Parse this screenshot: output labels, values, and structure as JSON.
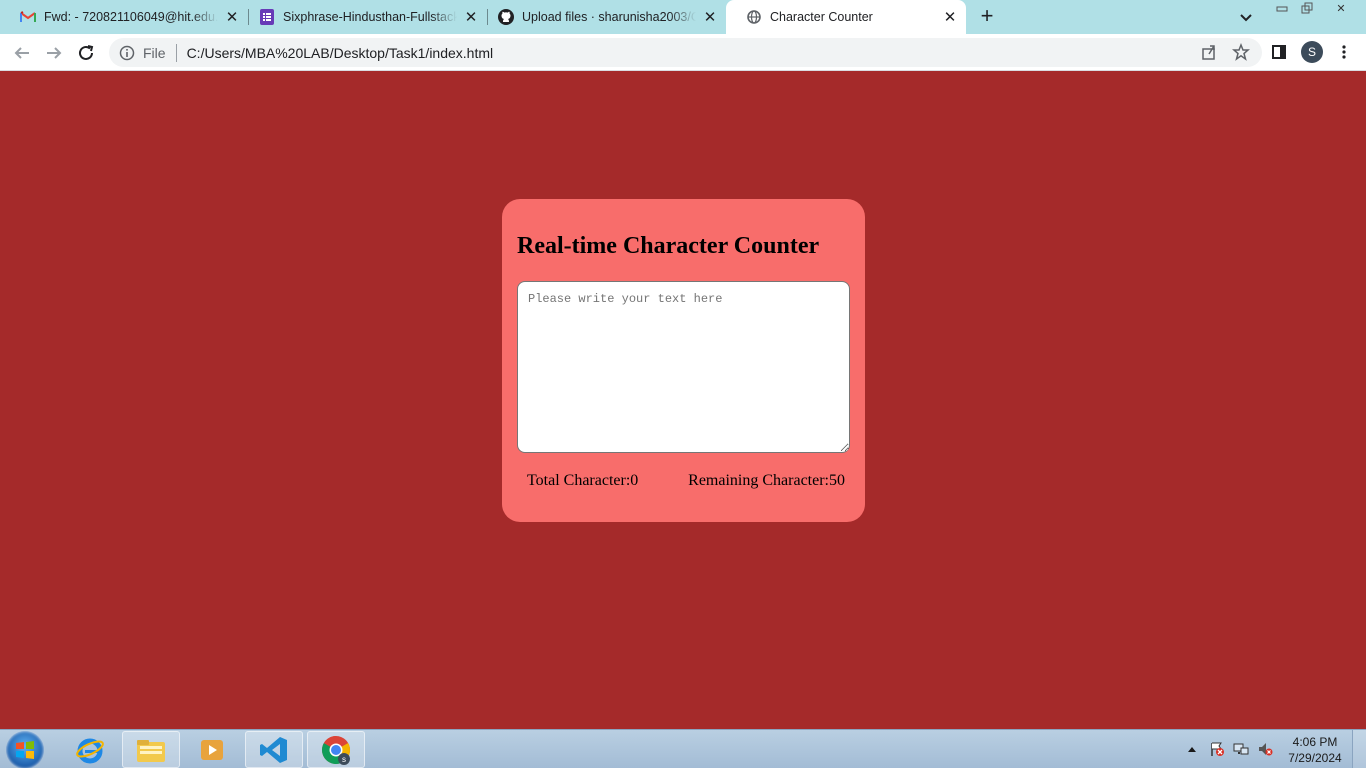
{
  "browser": {
    "tabs": [
      {
        "title": "Fwd: - 720821106049@hit.edu.in",
        "icon": "gmail-icon",
        "active": false
      },
      {
        "title": "Sixphrase-Hindusthan-Fullstack r",
        "icon": "forms-icon",
        "active": false
      },
      {
        "title": "Upload files · sharunisha2003/Ch",
        "icon": "github-icon",
        "active": false
      },
      {
        "title": "Character Counter",
        "icon": "globe-icon",
        "active": true
      }
    ],
    "address": {
      "scheme_label": "File",
      "url": "C:/Users/MBA%20LAB/Desktop/Task1/index.html"
    },
    "profile_initial": "S"
  },
  "page": {
    "background": "#a52a2a",
    "card_color": "#f86d6b",
    "heading": "Real-time Character Counter",
    "textarea_value": "",
    "textarea_placeholder": "Please write your text here",
    "total_label": "Total Character:0",
    "remaining_label": "Remaining Character:50"
  },
  "taskbar": {
    "apps": [
      "start-orb",
      "internet-explorer",
      "file-explorer",
      "media-player",
      "vscode",
      "chrome"
    ],
    "clock": {
      "time": "4:06 PM",
      "date": "7/29/2024"
    }
  }
}
